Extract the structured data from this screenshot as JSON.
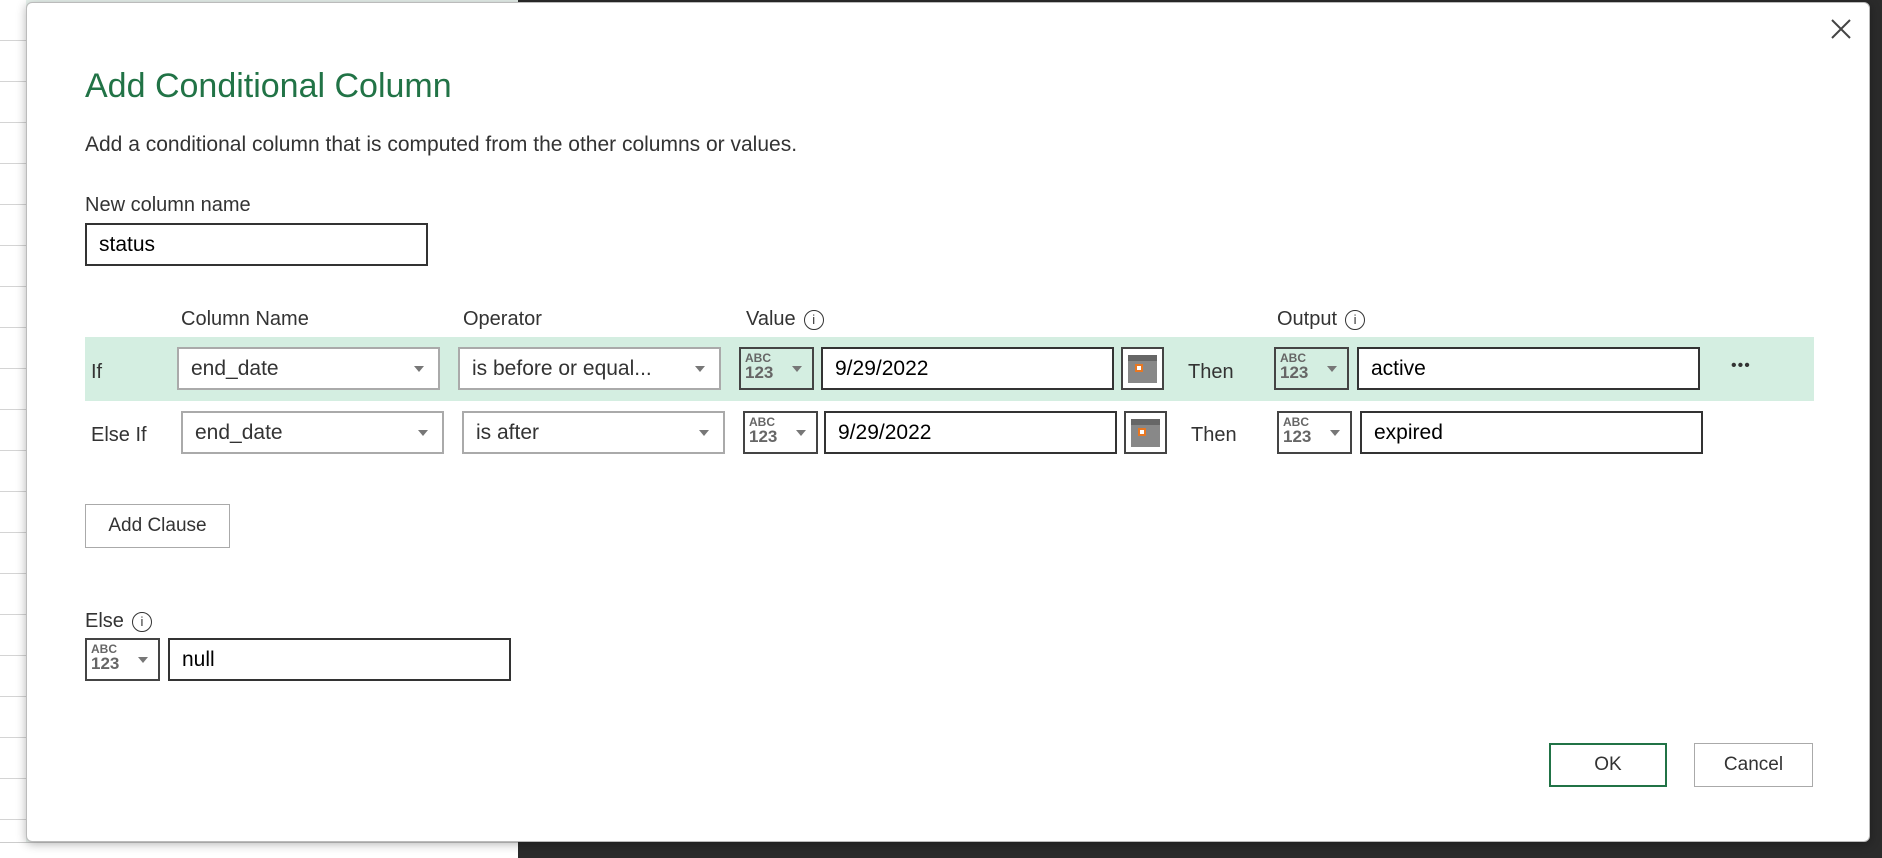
{
  "dialog": {
    "title": "Add Conditional Column",
    "subtitle": "Add a conditional column that is computed from the other columns or values.",
    "close_icon": "close-icon",
    "new_column_label": "New column name",
    "new_column_value": "status",
    "headers": {
      "column_name": "Column Name",
      "operator": "Operator",
      "value": "Value",
      "output": "Output",
      "info_glyph": "i"
    },
    "type_icon": {
      "top": "ABC",
      "bottom": "123"
    },
    "clauses": [
      {
        "label": "If",
        "column": "end_date",
        "operator": "is before or equal...",
        "value": "9/29/2022",
        "then": "Then",
        "output": "active",
        "more": "•••"
      },
      {
        "label": "Else If",
        "column": "end_date",
        "operator": "is after",
        "value": "9/29/2022",
        "then": "Then",
        "output": "expired"
      }
    ],
    "add_clause": "Add Clause",
    "else_label": "Else",
    "else_value": "null",
    "ok": "OK",
    "cancel": "Cancel",
    "colors": {
      "accent": "#217346",
      "highlight": "#d4eee1"
    }
  }
}
